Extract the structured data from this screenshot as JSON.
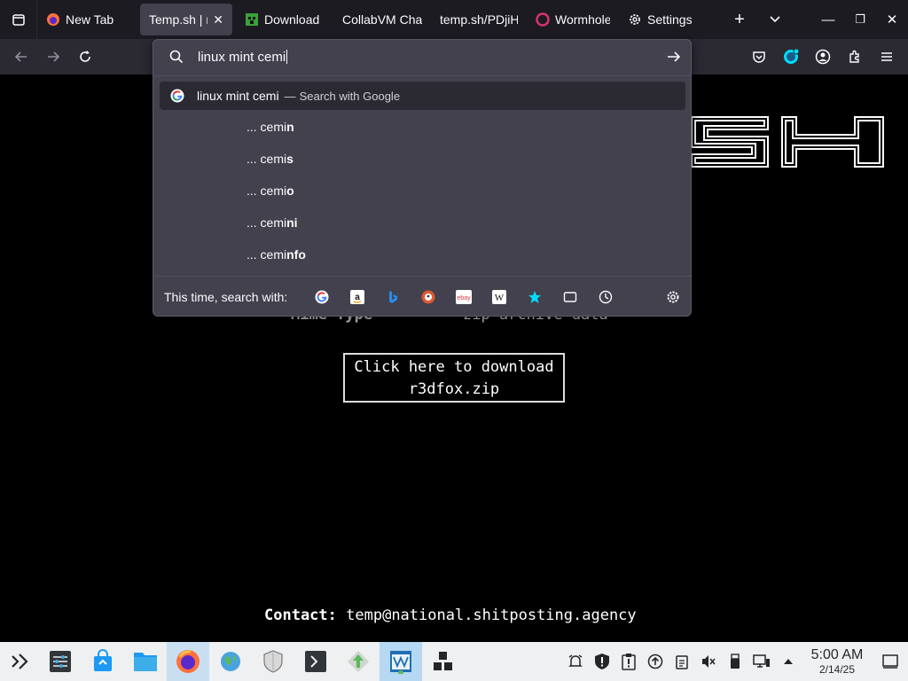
{
  "tabs": [
    {
      "label": "New Tab",
      "icon": "firefox-icon",
      "active": false
    },
    {
      "label": "Temp.sh | r",
      "icon": "",
      "active": true
    },
    {
      "label": "Download",
      "icon": "minecraft-icon",
      "active": false
    },
    {
      "label": "CollabVM Cha",
      "icon": "",
      "active": false
    },
    {
      "label": "temp.sh/PDjiH",
      "icon": "",
      "active": false
    },
    {
      "label": "Wormhole",
      "icon": "wormhole-icon",
      "active": false
    },
    {
      "label": "Settings",
      "icon": "gear-icon",
      "active": false
    }
  ],
  "urlbar": {
    "query": "linux mint cemi",
    "primary_suggestion": "linux mint cemi",
    "primary_dash": "—",
    "primary_action": "Search with Google",
    "suggestions": [
      {
        "prefix": "... cemi",
        "bold": "n"
      },
      {
        "prefix": "... cemi",
        "bold": "s"
      },
      {
        "prefix": "... cemi",
        "bold": "o"
      },
      {
        "prefix": "... cemi",
        "bold": "ni"
      },
      {
        "prefix": "... cemi",
        "bold": "nfo"
      }
    ],
    "oneoff_label": "This time, search with:",
    "engines": [
      "google-icon",
      "amazon-icon",
      "bing-icon",
      "duckduckgo-icon",
      "ebay-icon",
      "wikipedia-icon",
      "bookmarks-icon",
      "tabs-icon",
      "history-icon"
    ]
  },
  "page": {
    "mime_label": "Mime Type",
    "mime_value": "zip archive data",
    "download_line1": "Click here to download",
    "download_line2": "r3dfox.zip",
    "contact_label": "Contact:",
    "contact_value": "temp@national.shitposting.agency"
  },
  "clock": {
    "time": "5:00 AM",
    "date": "2/14/25"
  },
  "colors": {
    "tab_bg": "#1c1b22",
    "nav_bg": "#2b2a33",
    "panel_bg": "#42414d",
    "taskbar_bg": "#eff0f1",
    "accent": "#00ddff"
  }
}
